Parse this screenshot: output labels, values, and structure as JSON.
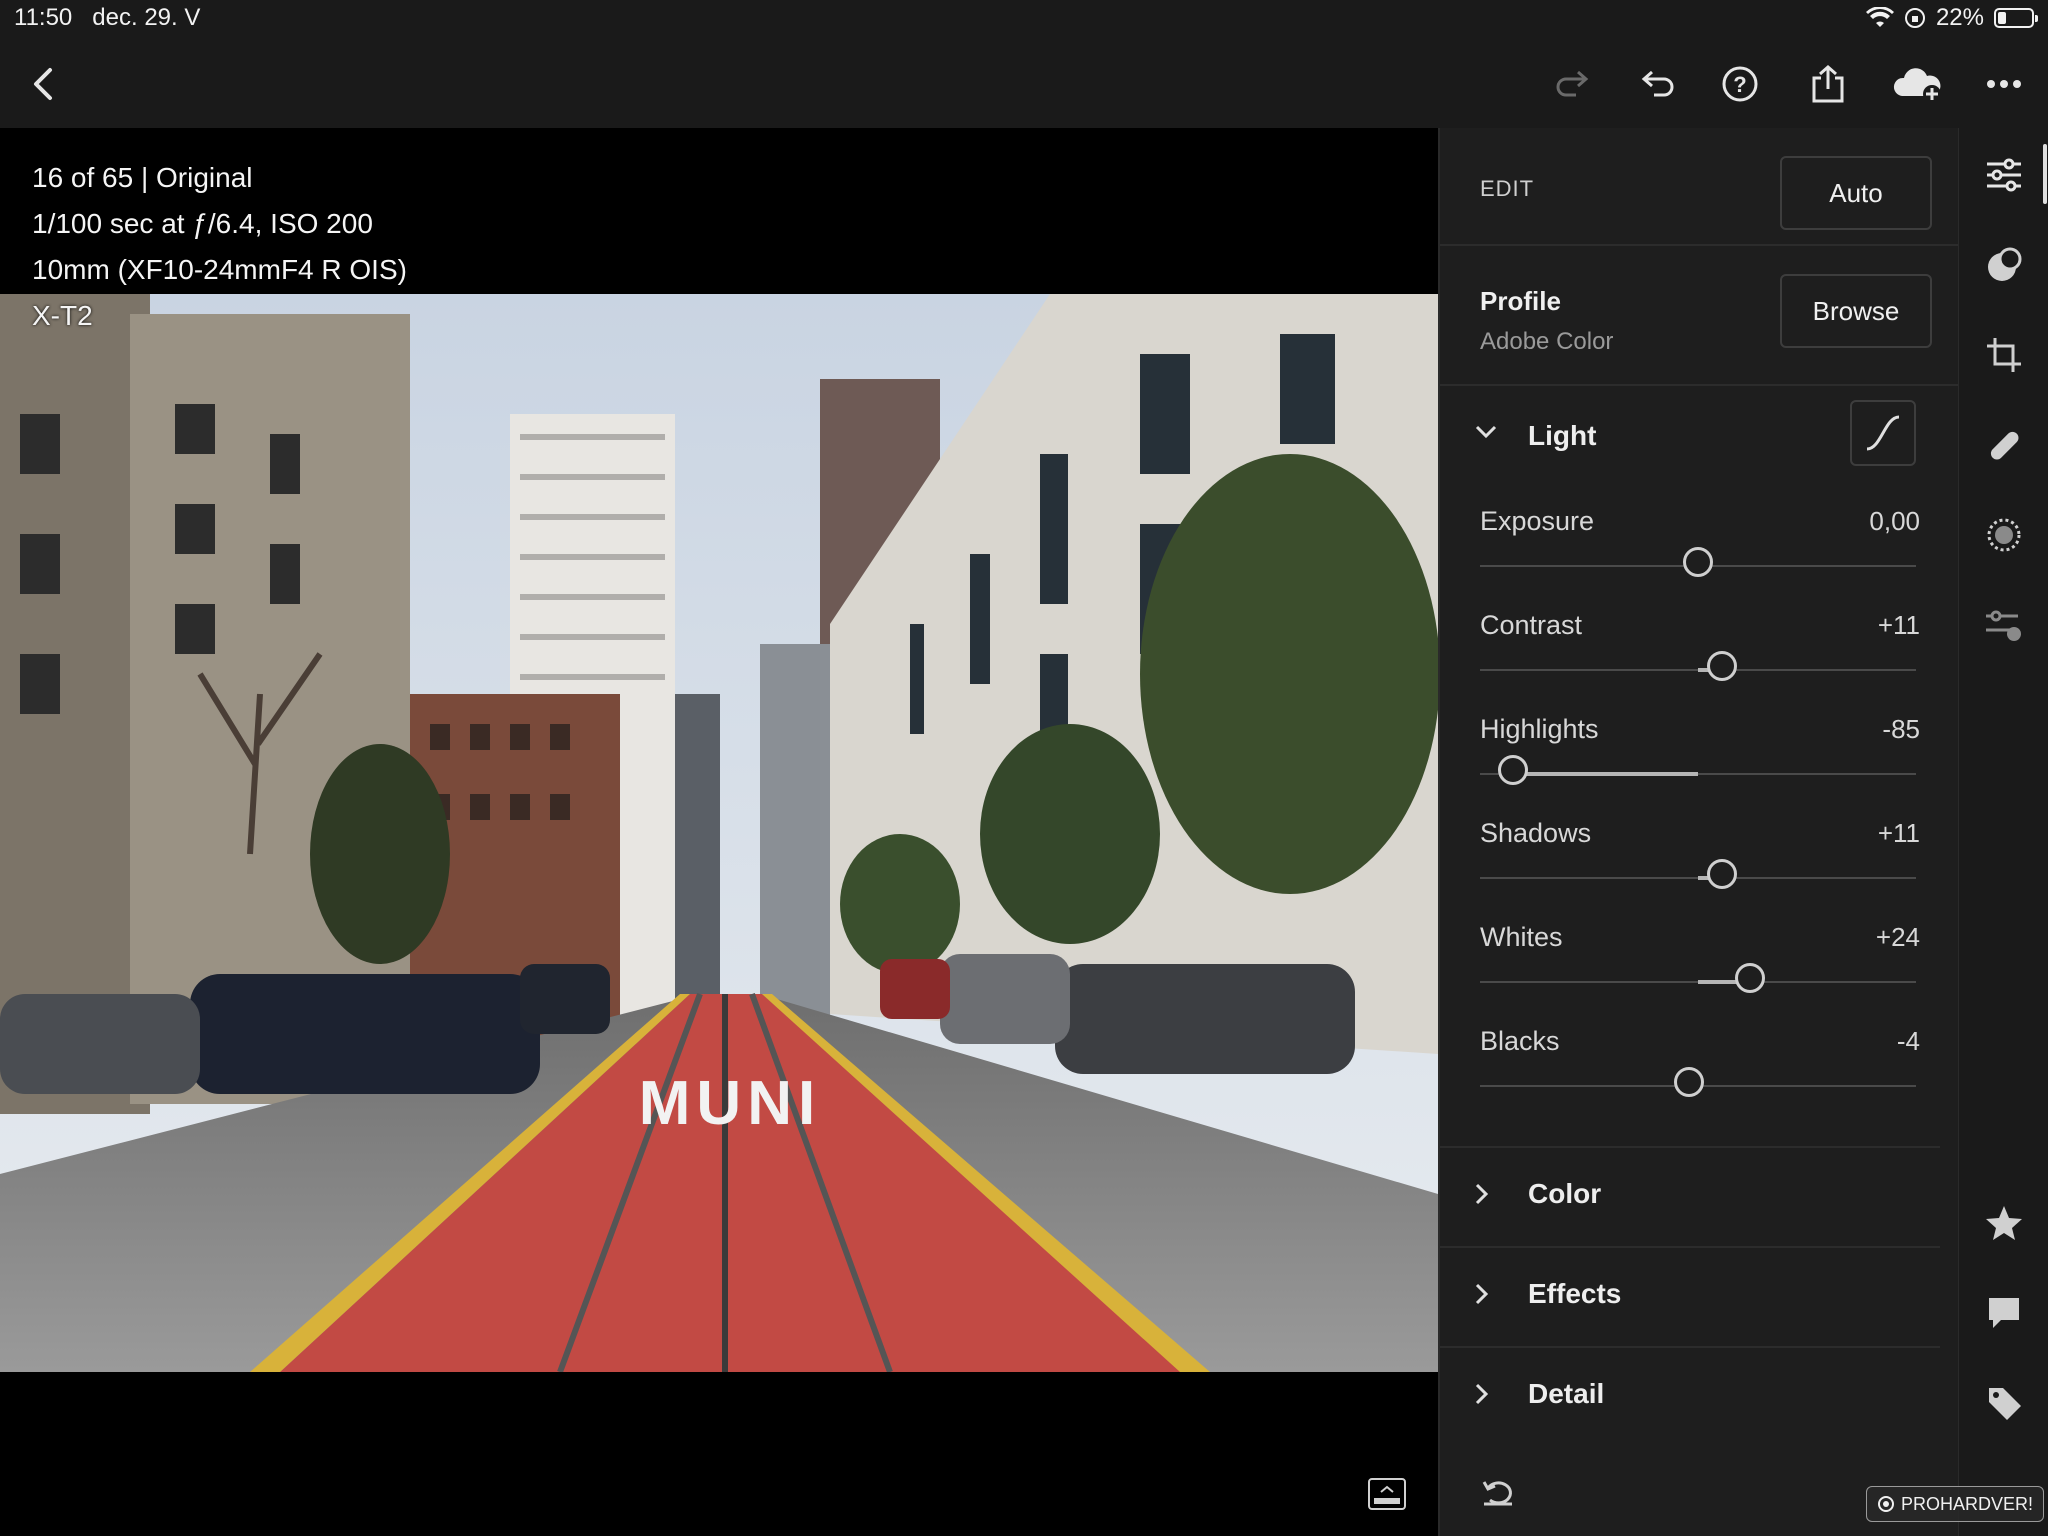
{
  "status": {
    "time": "11:50",
    "date": "dec. 29. V",
    "battery": "22%"
  },
  "photo_info": {
    "line1": "16 of 65 | Original",
    "line2": "1/100 sec at ƒ/6.4, ISO 200",
    "line3": "10mm (XF10-24mmF4 R OIS)",
    "line4": "X-T2"
  },
  "edit": {
    "header": "EDIT",
    "auto_label": "Auto",
    "profile_title": "Profile",
    "profile_name": "Adobe Color",
    "browse_label": "Browse",
    "light_title": "Light",
    "sliders": [
      {
        "label": "Exposure",
        "value": "0,00",
        "position": 0.5
      },
      {
        "label": "Contrast",
        "value": "+11",
        "position": 0.555
      },
      {
        "label": "Highlights",
        "value": "-85",
        "position": 0.075
      },
      {
        "label": "Shadows",
        "value": "+11",
        "position": 0.555
      },
      {
        "label": "Whites",
        "value": "+24",
        "position": 0.62
      },
      {
        "label": "Blacks",
        "value": "-4",
        "position": 0.48
      }
    ],
    "sections": [
      "Color",
      "Effects",
      "Detail"
    ]
  },
  "watermark": "PROHARDVER!"
}
